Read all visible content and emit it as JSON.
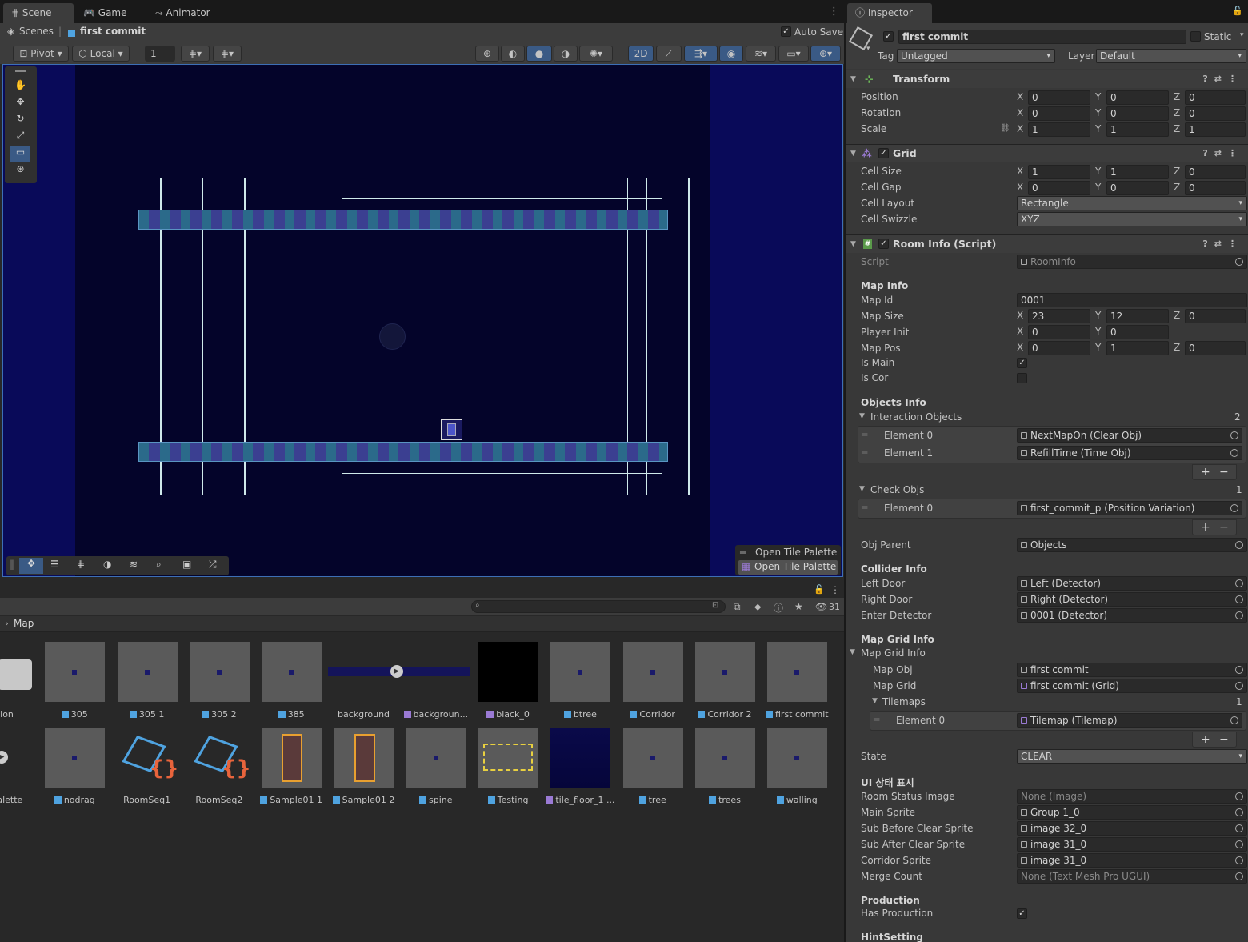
{
  "scene": {
    "tabs": [
      "Scene",
      "Game",
      "Animator"
    ],
    "breadcrumb_root": "Scenes",
    "breadcrumb_scene": "first commit",
    "auto_save_label": "Auto Save",
    "auto_save_checked": true,
    "toolbar": {
      "pivot": "Pivot",
      "local": "Local",
      "grid_snap_value": "1",
      "mode_2d": "2D"
    },
    "overlay": {
      "palette_title": "Open Tile Palette",
      "palette_button": "Open Tile Palette"
    }
  },
  "project": {
    "breadcrumb": "Map",
    "hidden_count": "31",
    "search_placeholder": "",
    "row1": [
      {
        "name": "ation",
        "type": "folder"
      },
      {
        "name": "305",
        "type": "prefab"
      },
      {
        "name": "305 1",
        "type": "prefab"
      },
      {
        "name": "305 2",
        "type": "prefab"
      },
      {
        "name": "385",
        "type": "prefab"
      },
      {
        "name": "background",
        "type": "image"
      },
      {
        "name": "backgroun...",
        "type": "material"
      },
      {
        "name": "black_0",
        "type": "material"
      },
      {
        "name": "btree",
        "type": "prefab"
      },
      {
        "name": "Corridor",
        "type": "prefab"
      },
      {
        "name": "Corridor 2",
        "type": "prefab"
      },
      {
        "name": "first commit",
        "type": "prefab"
      }
    ],
    "row2": [
      {
        "name": "w Palette",
        "type": "palette"
      },
      {
        "name": "nodrag",
        "type": "prefab"
      },
      {
        "name": "RoomSeq1",
        "type": "script"
      },
      {
        "name": "RoomSeq2",
        "type": "script"
      },
      {
        "name": "Sample01 1",
        "type": "prefab"
      },
      {
        "name": "Sample01 2",
        "type": "prefab"
      },
      {
        "name": "spine",
        "type": "prefab"
      },
      {
        "name": "Testing",
        "type": "prefab"
      },
      {
        "name": "tile_floor_1 ...",
        "type": "material"
      },
      {
        "name": "tree",
        "type": "prefab"
      },
      {
        "name": "trees",
        "type": "prefab"
      },
      {
        "name": "walling",
        "type": "prefab"
      }
    ]
  },
  "inspector": {
    "tab": "Inspector",
    "object_name": "first commit",
    "static_label": "Static",
    "tag_label": "Tag",
    "tag_value": "Untagged",
    "layer_label": "Layer",
    "layer_value": "Default",
    "transform": {
      "title": "Transform",
      "position_label": "Position",
      "position": [
        "0",
        "0",
        "0"
      ],
      "rotation_label": "Rotation",
      "rotation": [
        "0",
        "0",
        "0"
      ],
      "scale_label": "Scale",
      "scale": [
        "1",
        "1",
        "1"
      ]
    },
    "grid": {
      "title": "Grid",
      "cell_size_label": "Cell Size",
      "cell_size": [
        "1",
        "1",
        "0"
      ],
      "cell_gap_label": "Cell Gap",
      "cell_gap": [
        "0",
        "0",
        "0"
      ],
      "cell_layout_label": "Cell Layout",
      "cell_layout": "Rectangle",
      "cell_swizzle_label": "Cell Swizzle",
      "cell_swizzle": "XYZ"
    },
    "room": {
      "title": "Room Info (Script)",
      "script_label": "Script",
      "script_value": "RoomInfo",
      "map_info_header": "Map Info",
      "map_id_label": "Map Id",
      "map_id": "0001",
      "map_size_label": "Map Size",
      "map_size": [
        "23",
        "12",
        "0"
      ],
      "player_init_label": "Player Init",
      "player_init": [
        "0",
        "0"
      ],
      "map_pos_label": "Map Pos",
      "map_pos": [
        "0",
        "1",
        "0"
      ],
      "is_main_label": "Is Main",
      "is_main": true,
      "is_cor_label": "Is Cor",
      "is_cor": false,
      "objects_info_header": "Objects Info",
      "interaction_label": "Interaction Objects",
      "interaction_count": "2",
      "interaction": [
        {
          "label": "Element 0",
          "value": "NextMapOn (Clear Obj)"
        },
        {
          "label": "Element 1",
          "value": "RefillTime (Time Obj)"
        }
      ],
      "check_label": "Check Objs",
      "check_count": "1",
      "check": [
        {
          "label": "Element 0",
          "value": "first_commit_p (Position Variation)"
        }
      ],
      "obj_parent_label": "Obj Parent",
      "obj_parent": "Objects",
      "collider_header": "Collider Info",
      "left_door_label": "Left Door",
      "left_door": "Left (Detector)",
      "right_door_label": "Right Door",
      "right_door": "Right (Detector)",
      "enter_detector_label": "Enter Detector",
      "enter_detector": "0001 (Detector)",
      "map_grid_header": "Map Grid Info",
      "map_grid_foldout": "Map Grid Info",
      "map_obj_label": "Map Obj",
      "map_obj": "first commit",
      "map_grid_label": "Map Grid",
      "map_grid": "first commit (Grid)",
      "tilemaps_label": "Tilemaps",
      "tilemaps_count": "1",
      "tilemaps": [
        {
          "label": "Element 0",
          "value": "Tilemap (Tilemap)"
        }
      ],
      "state_label": "State",
      "state": "CLEAR",
      "ui_header": "UI 상태 표시",
      "room_status_label": "Room Status Image",
      "room_status": "None (Image)",
      "main_sprite_label": "Main Sprite",
      "main_sprite": "Group 1_0",
      "sub_before_label": "Sub Before Clear Sprite",
      "sub_before": "image 32_0",
      "sub_after_label": "Sub After Clear Sprite",
      "sub_after": "image 31_0",
      "corridor_sprite_label": "Corridor Sprite",
      "corridor_sprite": "image 31_0",
      "merge_count_label": "Merge Count",
      "merge_count": "None (Text Mesh Pro UGUI)",
      "production_header": "Production",
      "has_production_label": "Has Production",
      "has_production": true,
      "hint_header": "HintSetting"
    }
  },
  "colors": {
    "viewport_bg": "#04042a",
    "accent": "#3a5a85",
    "tile_a": "#2b6a8a",
    "tile_b": "#3b3f91"
  }
}
